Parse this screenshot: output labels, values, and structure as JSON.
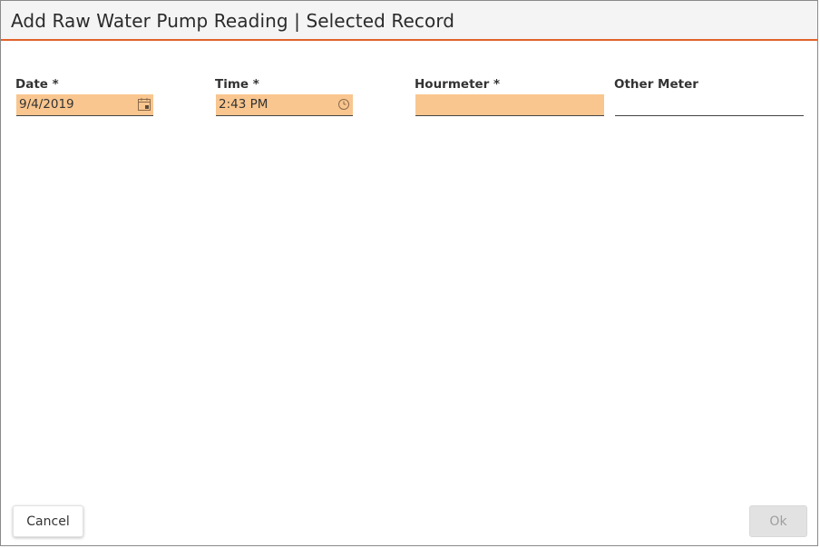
{
  "dialog": {
    "title": "Add Raw Water Pump Reading | Selected Record"
  },
  "fields": {
    "date": {
      "label": "Date *",
      "value": "9/4/2019",
      "icon": "calendar-icon"
    },
    "time": {
      "label": "Time *",
      "value": "2:43 PM",
      "icon": "clock-icon"
    },
    "hourmeter": {
      "label": "Hourmeter *",
      "value": ""
    },
    "other_meter": {
      "label": "Other Meter",
      "value": ""
    }
  },
  "buttons": {
    "cancel_label": "Cancel",
    "ok_label": "Ok"
  },
  "colors": {
    "accent": "#e0622a",
    "required_field_bg": "#f9c68f",
    "disabled_button_bg": "#e2e2e2"
  }
}
